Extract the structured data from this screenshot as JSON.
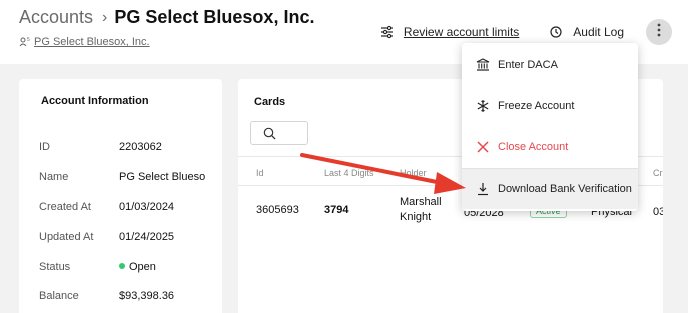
{
  "breadcrumb": {
    "root": "Accounts",
    "separator": "›",
    "title": "PG Select Bluesox, Inc."
  },
  "sub_link": {
    "icon": "user-count-icon",
    "text": "PG Select Bluesox, Inc."
  },
  "header_actions": {
    "review": {
      "icon": "sliders-icon",
      "label": "Review account limits"
    },
    "audit": {
      "icon": "history-icon",
      "label": "Audit Log"
    },
    "more": {
      "icon": "more-vertical-icon"
    }
  },
  "account_info": {
    "title": "Account Information",
    "rows": [
      {
        "label": "ID",
        "value": "2203062"
      },
      {
        "label": "Name",
        "value": "PG Select Blueso"
      },
      {
        "label": "Created At",
        "value": "01/03/2024"
      },
      {
        "label": "Updated At",
        "value": "01/24/2025"
      },
      {
        "label": "Status",
        "value": "Open"
      },
      {
        "label": "Balance",
        "value": "$93,398.36"
      }
    ],
    "status_color": "#2ecc71"
  },
  "cards": {
    "title": "Cards",
    "search_icon": "search-icon",
    "columns": [
      "Id",
      "Last 4 Digits",
      "Holder",
      "",
      "",
      "",
      "Cr"
    ],
    "row": {
      "id": "3605693",
      "last4": "3794",
      "holder_first": "Marshall",
      "holder_last": "Knight",
      "expiry": "05/2028",
      "status": "Active",
      "type": "Physical",
      "created": "03"
    }
  },
  "menu": {
    "items": [
      {
        "label": "Enter DACA",
        "icon": "bank-icon"
      },
      {
        "label": "Freeze Account",
        "icon": "snowflake-icon"
      },
      {
        "label": "Close Account",
        "icon": "close-icon"
      },
      {
        "label": "Download Bank Verification",
        "icon": "download-icon"
      }
    ]
  },
  "colors": {
    "accent_red": "#e53b2c",
    "danger": "#e5484d",
    "success": "#2e9a4e",
    "page_bg": "#f2f2f2"
  }
}
